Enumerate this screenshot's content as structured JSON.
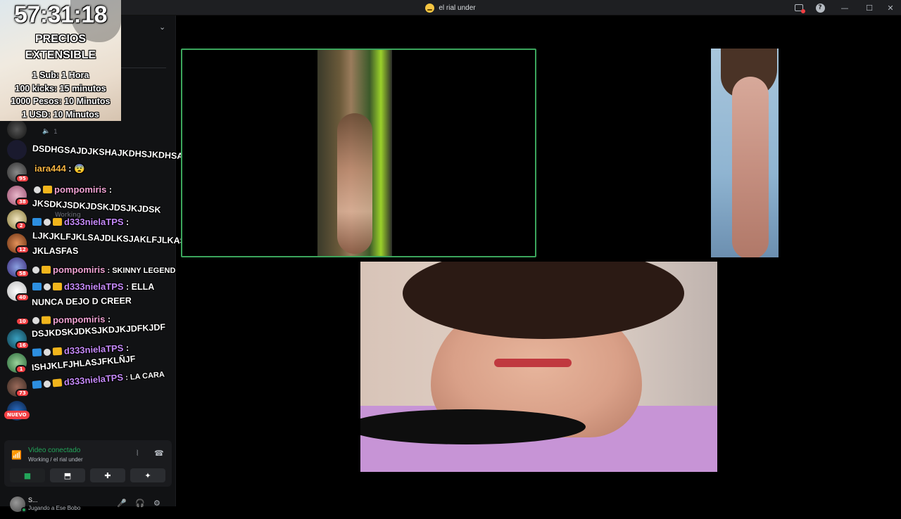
{
  "window": {
    "title": "el rial under"
  },
  "overlay": {
    "timer": "57:31:18",
    "heading_line1": "PRECIOS",
    "heading_line2": "EXTENSIBLE",
    "prices": [
      "1 Sub: 1 Hora",
      "100 kicks: 15 minutos",
      "1000 Pesos: 10 Minutos",
      "1 USD: 10 Minutos"
    ]
  },
  "channels": {
    "voice_count": "1",
    "status_channel": "Working",
    "nuevo_label": "NUEVO"
  },
  "server_badges": [
    "95",
    "38",
    "2",
    "12",
    "58",
    "40",
    "10",
    "16",
    "1",
    "73"
  ],
  "chat": {
    "messages": [
      {
        "user": "",
        "text": "DSDHGSAJDJKSHAJKDHSJKDHSAD"
      },
      {
        "user": "iara444",
        "sep": " : ",
        "text": "😨"
      },
      {
        "user": "pompomiris",
        "sep": " :",
        "text": ""
      },
      {
        "user": "",
        "text": "JKSDKJSDKJDSKJDSJKJDSK"
      },
      {
        "user": "d333nielaTPS",
        "sep": " :",
        "text": ""
      },
      {
        "user": "",
        "text": "LJKJKLFJKLSAJDLKSJAKLFJLKASF"
      },
      {
        "user": "",
        "text": "JKLASFAS"
      },
      {
        "user": "pompomiris",
        "sep": " : ",
        "text": "SKINNY LEGEND"
      },
      {
        "user": "d333nielaTPS",
        "sep": " : ",
        "text": "ELLA"
      },
      {
        "user": "",
        "text": "NUNCA DEJO D CREER"
      },
      {
        "user": "pompomiris",
        "sep": " :",
        "text": ""
      },
      {
        "user": "",
        "text": "DSJKDSKJDKSJKDJKJDFKJDF"
      },
      {
        "user": "d333nielaTPS",
        "sep": " :",
        "text": ""
      },
      {
        "user": "",
        "text": "ISHJKLFJHLASJFKLÑJF"
      },
      {
        "user": "d333nielaTPS",
        "sep": " : ",
        "text": "LA CARA"
      }
    ]
  },
  "voice_panel": {
    "status": "Video conectado",
    "location": "Working / el rial under"
  },
  "user_panel": {
    "name": "S...",
    "activity": "Jugando a Ese Bobo"
  },
  "colors": {
    "accent_green": "#23a55a",
    "badge_red": "#f23f43",
    "tile_border": "#3ba55c"
  }
}
